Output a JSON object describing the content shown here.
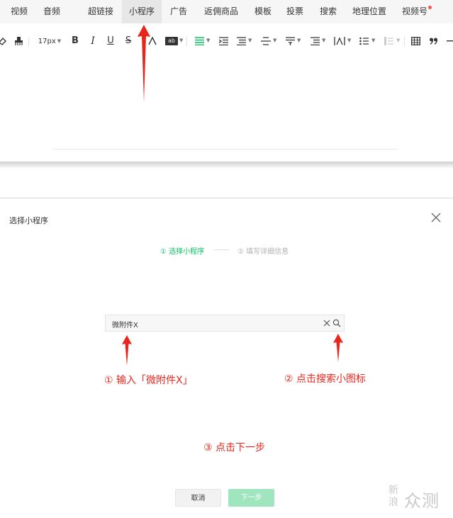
{
  "menu": {
    "items": [
      "视频",
      "音频",
      "超链接",
      "小程序",
      "广告",
      "返佣商品",
      "模板",
      "投票",
      "搜索",
      "地理位置",
      "视频号"
    ],
    "active_index": 3
  },
  "toolbar": {
    "font_size": "17px",
    "bold": "B",
    "italic": "I",
    "underline": "U",
    "strike": "S",
    "highlight": "ab"
  },
  "dialog": {
    "title": "选择小程序",
    "steps": [
      "① 选择小程序",
      "② 填写详细信息"
    ],
    "search_value": "微附件X",
    "cancel_label": "取消",
    "next_label": "下一步"
  },
  "annotations": {
    "input": "① 输入「微附件X」",
    "click_search": "② 点击搜索小图标",
    "click_next": "③ 点击下一步"
  },
  "colors": {
    "accent_green": "#07c160",
    "disabled_green": "#9fe6bf",
    "annotation_red": "#e8261c",
    "badge_red": "#fa5151"
  },
  "watermark": {
    "line1": "新",
    "line2": "浪",
    "text": "众测"
  }
}
